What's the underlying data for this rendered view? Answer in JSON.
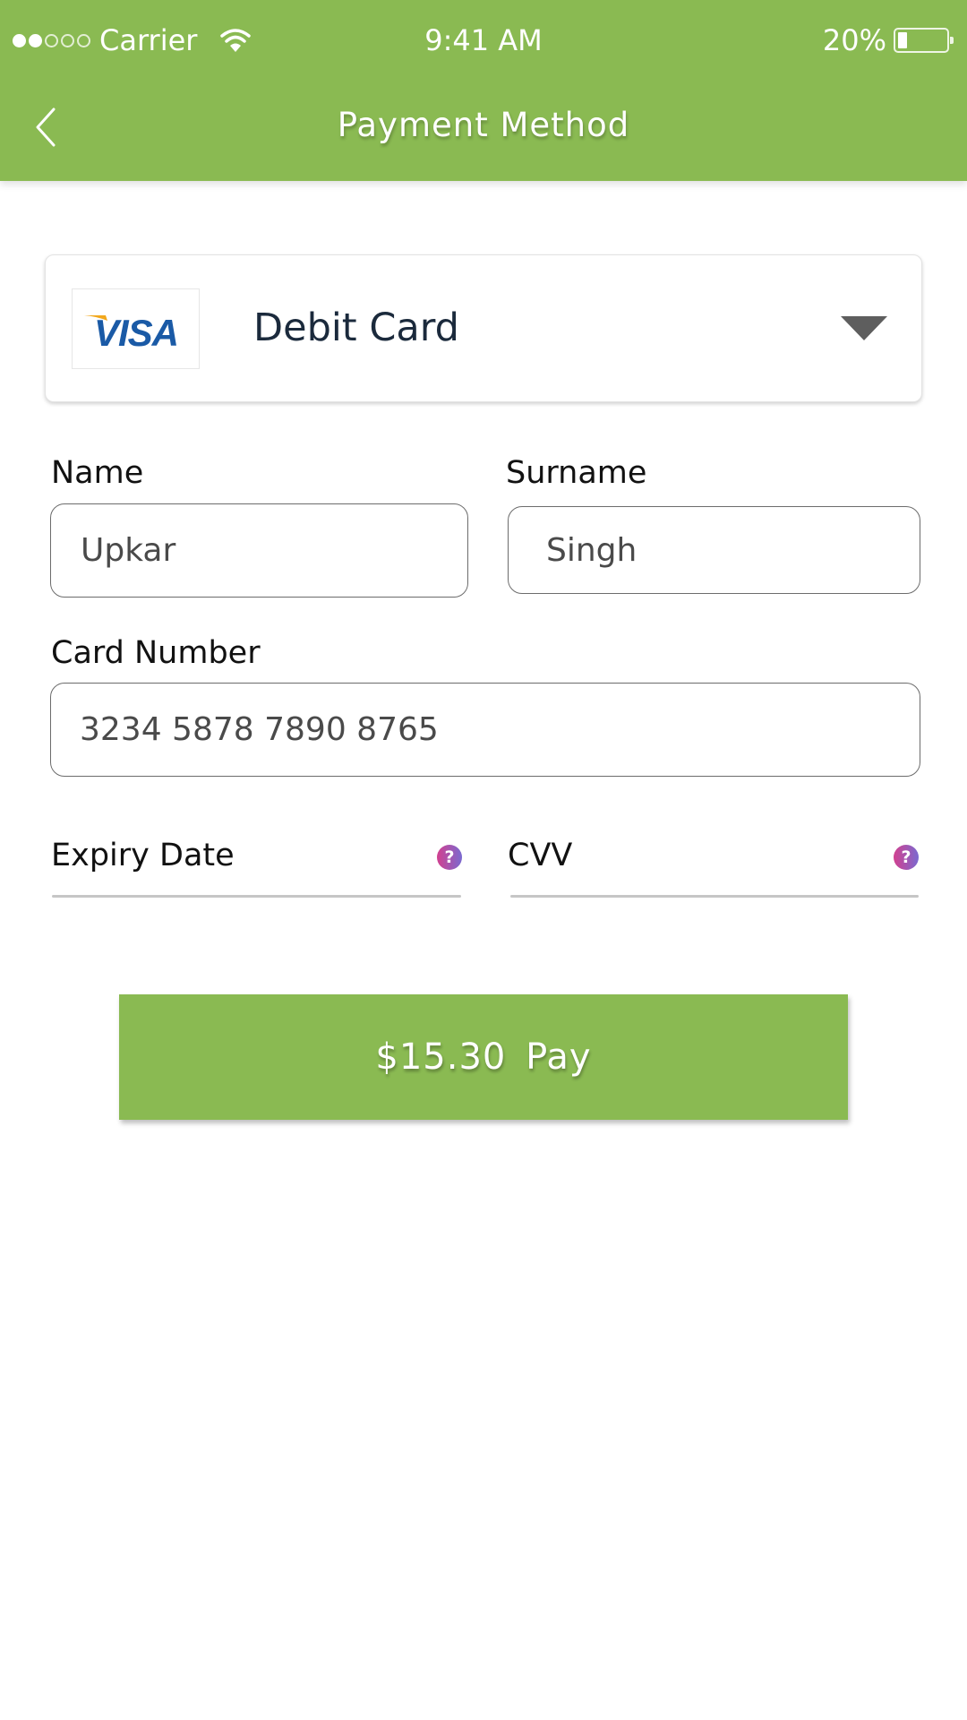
{
  "status_bar": {
    "signal_bars_filled": 2,
    "signal_bars_total": 5,
    "carrier": "Carrier",
    "wifi_icon": "wifi-icon",
    "time": "9:41 AM",
    "battery_percent_label": "20%",
    "battery_level": 0.2
  },
  "header": {
    "title": "Payment Method",
    "back_icon": "chevron-left-icon"
  },
  "payment_select": {
    "brand_logo": "VISA",
    "selected_value": "Debit Card",
    "dropdown_icon": "caret-down-icon"
  },
  "form": {
    "name": {
      "label": "Name",
      "value": "Upkar"
    },
    "surname": {
      "label": "Surname",
      "value": "Singh"
    },
    "card_number": {
      "label": "Card Number",
      "value": "3234 5878 7890 8765"
    },
    "expiry": {
      "label": "Expiry Date",
      "help_icon": "question-circle-icon",
      "help_glyph": "?"
    },
    "cvv": {
      "label": "CVV",
      "help_icon": "question-circle-icon",
      "help_glyph": "?"
    }
  },
  "pay_button": {
    "label": "$15.30  Pay"
  },
  "colors": {
    "brand_green": "#8aba52",
    "visa_blue": "#1a5aa6",
    "visa_gold": "#f2a81d",
    "help_gradient_start": "#d2408f",
    "help_gradient_end": "#7a6ad0"
  }
}
